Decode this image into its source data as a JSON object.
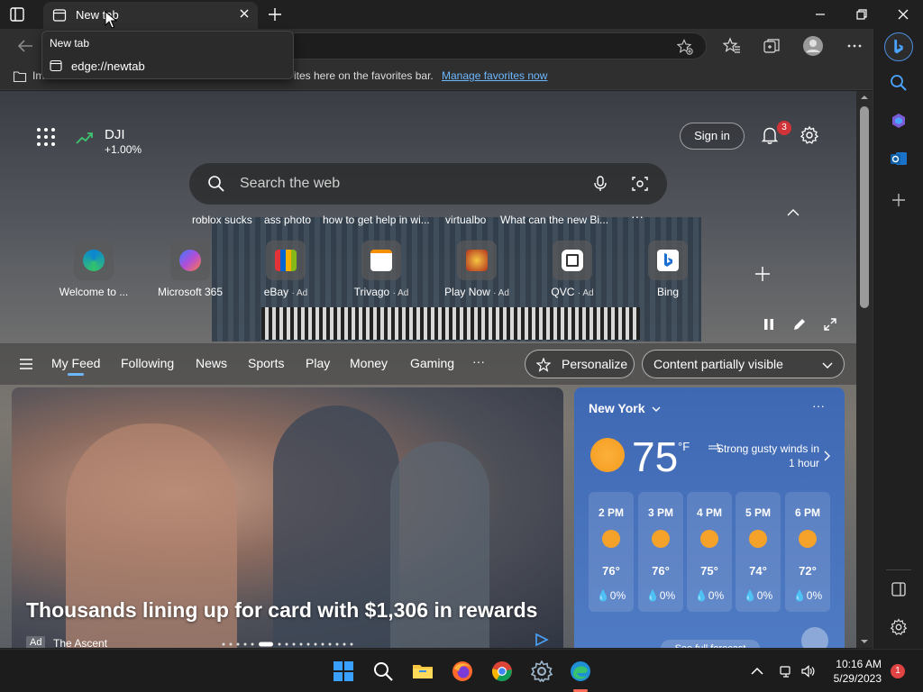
{
  "window": {
    "tab_title": "New tab",
    "tooltip_title": "New tab",
    "tooltip_url": "edge://newtab"
  },
  "favorites_bar": {
    "text": "Im",
    "text_tail": "ites here on the favorites bar.",
    "manage_link": "Manage favorites now"
  },
  "stock": {
    "name": "DJI",
    "change": "+1.00%"
  },
  "header": {
    "signin_label": "Sign in",
    "notification_count": "3"
  },
  "search": {
    "placeholder": "Search the web"
  },
  "trending": [
    {
      "label": "roblox sucks"
    },
    {
      "label": "ass photo"
    },
    {
      "label": "how to get help in wi..."
    },
    {
      "label": "virtualbo"
    },
    {
      "label": "What can the new Bi..."
    }
  ],
  "trending_more": "···",
  "quick_links": [
    {
      "label": "Welcome to ...",
      "ad": "",
      "color": "#1f8fd6"
    },
    {
      "label": "Microsoft 365",
      "ad": "",
      "color": "#7b5cd6"
    },
    {
      "label": "eBay",
      "ad": "· Ad",
      "color": "#e53238"
    },
    {
      "label": "Trivago",
      "ad": "· Ad",
      "color": "#f48f00"
    },
    {
      "label": "Play Now",
      "ad": "· Ad",
      "color": "#c0392b"
    },
    {
      "label": "QVC",
      "ad": "· Ad",
      "color": "#ffffff"
    },
    {
      "label": "Bing",
      "ad": "",
      "color": "#1b6fd1"
    }
  ],
  "feed_nav": [
    {
      "label": "My Feed"
    },
    {
      "label": "Following"
    },
    {
      "label": "News"
    },
    {
      "label": "Sports"
    },
    {
      "label": "Play"
    },
    {
      "label": "Money"
    },
    {
      "label": "Gaming"
    }
  ],
  "feed_more": "···",
  "feed_buttons": {
    "personalize": "Personalize",
    "visibility": "Content partially visible"
  },
  "story": {
    "headline": "Thousands lining up for card with $1,306 in rewards",
    "ad_tag": "Ad",
    "source": "The Ascent"
  },
  "weather": {
    "city": "New York",
    "menu": "···",
    "temperature": "75",
    "unit": "°F",
    "condition": "Strong gusty winds in 1 hour",
    "hours": [
      {
        "time": "2 PM",
        "temp": "76°",
        "precip": "0%"
      },
      {
        "time": "3 PM",
        "temp": "76°",
        "precip": "0%"
      },
      {
        "time": "4 PM",
        "temp": "75°",
        "precip": "0%"
      },
      {
        "time": "5 PM",
        "temp": "74°",
        "precip": "0%"
      },
      {
        "time": "6 PM",
        "temp": "72°",
        "precip": "0%"
      }
    ],
    "full_forecast": "See full forecast"
  },
  "taskbar": {
    "time": "10:16 AM",
    "date": "5/29/2023",
    "notification_count": "1"
  },
  "colors": {
    "accent": "#6cb8ff",
    "badge": "#d13438",
    "sun": "#f5a22a"
  }
}
